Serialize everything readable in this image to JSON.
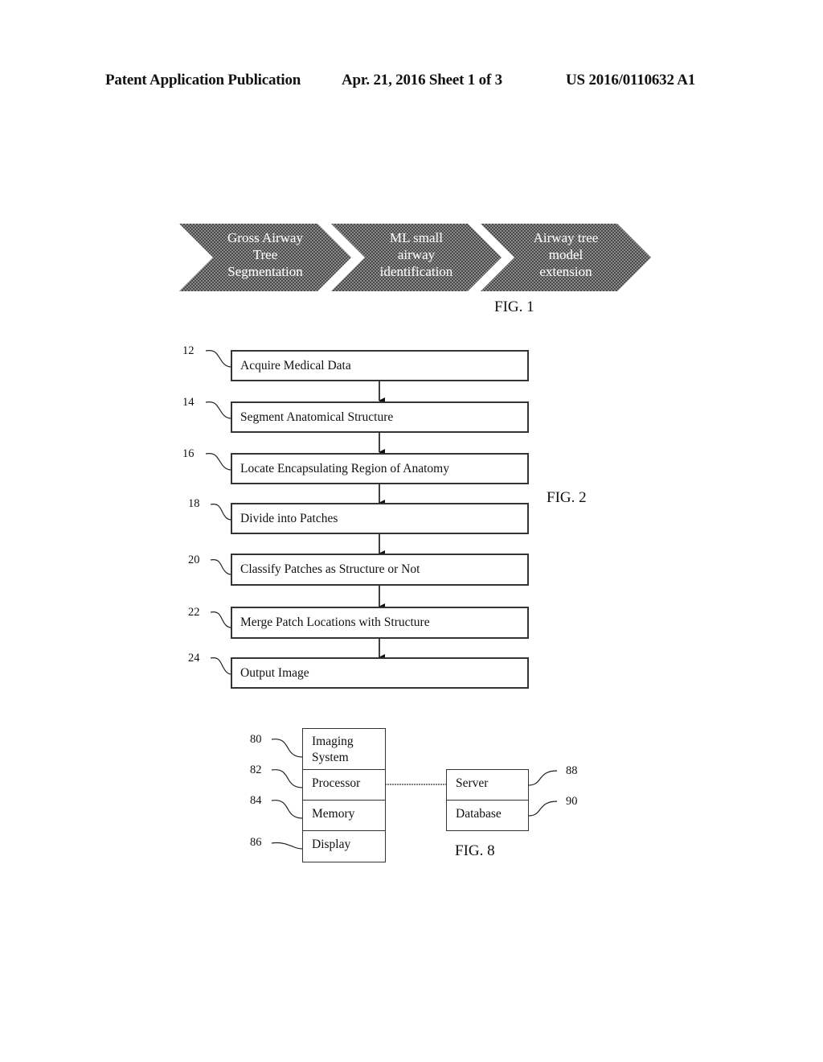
{
  "header": {
    "publication": "Patent Application Publication",
    "date_sheet": "Apr. 21, 2016  Sheet 1 of 3",
    "number": "US 2016/0110632 A1"
  },
  "fig1": {
    "label": "FIG. 1",
    "steps": [
      {
        "text": "Gross Airway\nTree\nSegmentation"
      },
      {
        "text": "ML small\nairway\nidentification"
      },
      {
        "text": "Airway tree\nmodel\nextension"
      }
    ]
  },
  "fig2": {
    "label": "FIG. 2",
    "steps": [
      {
        "ref": "12",
        "text": "Acquire Medical Data"
      },
      {
        "ref": "14",
        "text": "Segment Anatomical Structure"
      },
      {
        "ref": "16",
        "text": "Locate Encapsulating Region of Anatomy"
      },
      {
        "ref": "18",
        "text": "Divide into Patches"
      },
      {
        "ref": "20",
        "text": "Classify Patches as Structure or Not"
      },
      {
        "ref": "22",
        "text": "Merge Patch Locations with Structure"
      },
      {
        "ref": "24",
        "text": "Output Image"
      }
    ]
  },
  "fig8": {
    "label": "FIG. 8",
    "system": [
      {
        "ref": "80",
        "text": "Imaging\nSystem"
      },
      {
        "ref": "82",
        "text": "Processor"
      },
      {
        "ref": "84",
        "text": "Memory"
      },
      {
        "ref": "86",
        "text": "Display"
      }
    ],
    "remote": [
      {
        "ref": "88",
        "text": "Server"
      },
      {
        "ref": "90",
        "text": "Database"
      }
    ]
  }
}
